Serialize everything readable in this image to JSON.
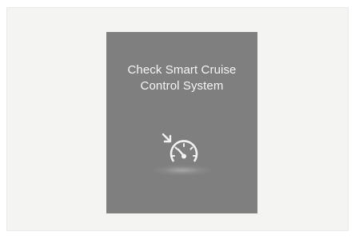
{
  "warning": {
    "line1": "Check Smart Cruise",
    "line2": "Control System",
    "icon": "smart-cruise-control-icon"
  },
  "colors": {
    "background": "#f4f4f3",
    "panel": "#7f7f7f",
    "text": "#f5f5f5"
  }
}
